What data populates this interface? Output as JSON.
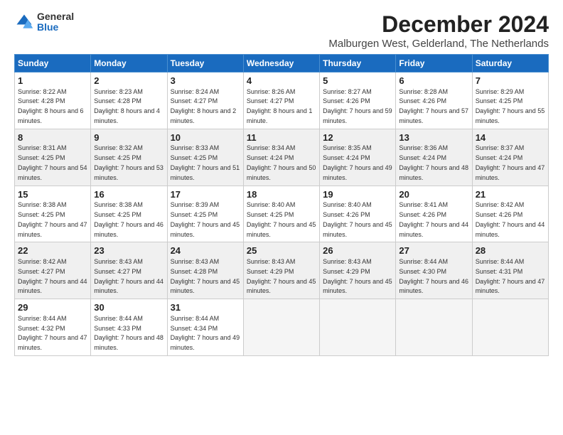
{
  "logo": {
    "general": "General",
    "blue": "Blue"
  },
  "title": "December 2024",
  "subtitle": "Malburgen West, Gelderland, The Netherlands",
  "headers": [
    "Sunday",
    "Monday",
    "Tuesday",
    "Wednesday",
    "Thursday",
    "Friday",
    "Saturday"
  ],
  "weeks": [
    [
      {
        "day": "1",
        "sunrise": "Sunrise: 8:22 AM",
        "sunset": "Sunset: 4:28 PM",
        "daylight": "Daylight: 8 hours and 6 minutes."
      },
      {
        "day": "2",
        "sunrise": "Sunrise: 8:23 AM",
        "sunset": "Sunset: 4:28 PM",
        "daylight": "Daylight: 8 hours and 4 minutes."
      },
      {
        "day": "3",
        "sunrise": "Sunrise: 8:24 AM",
        "sunset": "Sunset: 4:27 PM",
        "daylight": "Daylight: 8 hours and 2 minutes."
      },
      {
        "day": "4",
        "sunrise": "Sunrise: 8:26 AM",
        "sunset": "Sunset: 4:27 PM",
        "daylight": "Daylight: 8 hours and 1 minute."
      },
      {
        "day": "5",
        "sunrise": "Sunrise: 8:27 AM",
        "sunset": "Sunset: 4:26 PM",
        "daylight": "Daylight: 7 hours and 59 minutes."
      },
      {
        "day": "6",
        "sunrise": "Sunrise: 8:28 AM",
        "sunset": "Sunset: 4:26 PM",
        "daylight": "Daylight: 7 hours and 57 minutes."
      },
      {
        "day": "7",
        "sunrise": "Sunrise: 8:29 AM",
        "sunset": "Sunset: 4:25 PM",
        "daylight": "Daylight: 7 hours and 55 minutes."
      }
    ],
    [
      {
        "day": "8",
        "sunrise": "Sunrise: 8:31 AM",
        "sunset": "Sunset: 4:25 PM",
        "daylight": "Daylight: 7 hours and 54 minutes."
      },
      {
        "day": "9",
        "sunrise": "Sunrise: 8:32 AM",
        "sunset": "Sunset: 4:25 PM",
        "daylight": "Daylight: 7 hours and 53 minutes."
      },
      {
        "day": "10",
        "sunrise": "Sunrise: 8:33 AM",
        "sunset": "Sunset: 4:25 PM",
        "daylight": "Daylight: 7 hours and 51 minutes."
      },
      {
        "day": "11",
        "sunrise": "Sunrise: 8:34 AM",
        "sunset": "Sunset: 4:24 PM",
        "daylight": "Daylight: 7 hours and 50 minutes."
      },
      {
        "day": "12",
        "sunrise": "Sunrise: 8:35 AM",
        "sunset": "Sunset: 4:24 PM",
        "daylight": "Daylight: 7 hours and 49 minutes."
      },
      {
        "day": "13",
        "sunrise": "Sunrise: 8:36 AM",
        "sunset": "Sunset: 4:24 PM",
        "daylight": "Daylight: 7 hours and 48 minutes."
      },
      {
        "day": "14",
        "sunrise": "Sunrise: 8:37 AM",
        "sunset": "Sunset: 4:24 PM",
        "daylight": "Daylight: 7 hours and 47 minutes."
      }
    ],
    [
      {
        "day": "15",
        "sunrise": "Sunrise: 8:38 AM",
        "sunset": "Sunset: 4:25 PM",
        "daylight": "Daylight: 7 hours and 47 minutes."
      },
      {
        "day": "16",
        "sunrise": "Sunrise: 8:38 AM",
        "sunset": "Sunset: 4:25 PM",
        "daylight": "Daylight: 7 hours and 46 minutes."
      },
      {
        "day": "17",
        "sunrise": "Sunrise: 8:39 AM",
        "sunset": "Sunset: 4:25 PM",
        "daylight": "Daylight: 7 hours and 45 minutes."
      },
      {
        "day": "18",
        "sunrise": "Sunrise: 8:40 AM",
        "sunset": "Sunset: 4:25 PM",
        "daylight": "Daylight: 7 hours and 45 minutes."
      },
      {
        "day": "19",
        "sunrise": "Sunrise: 8:40 AM",
        "sunset": "Sunset: 4:26 PM",
        "daylight": "Daylight: 7 hours and 45 minutes."
      },
      {
        "day": "20",
        "sunrise": "Sunrise: 8:41 AM",
        "sunset": "Sunset: 4:26 PM",
        "daylight": "Daylight: 7 hours and 44 minutes."
      },
      {
        "day": "21",
        "sunrise": "Sunrise: 8:42 AM",
        "sunset": "Sunset: 4:26 PM",
        "daylight": "Daylight: 7 hours and 44 minutes."
      }
    ],
    [
      {
        "day": "22",
        "sunrise": "Sunrise: 8:42 AM",
        "sunset": "Sunset: 4:27 PM",
        "daylight": "Daylight: 7 hours and 44 minutes."
      },
      {
        "day": "23",
        "sunrise": "Sunrise: 8:43 AM",
        "sunset": "Sunset: 4:27 PM",
        "daylight": "Daylight: 7 hours and 44 minutes."
      },
      {
        "day": "24",
        "sunrise": "Sunrise: 8:43 AM",
        "sunset": "Sunset: 4:28 PM",
        "daylight": "Daylight: 7 hours and 45 minutes."
      },
      {
        "day": "25",
        "sunrise": "Sunrise: 8:43 AM",
        "sunset": "Sunset: 4:29 PM",
        "daylight": "Daylight: 7 hours and 45 minutes."
      },
      {
        "day": "26",
        "sunrise": "Sunrise: 8:43 AM",
        "sunset": "Sunset: 4:29 PM",
        "daylight": "Daylight: 7 hours and 45 minutes."
      },
      {
        "day": "27",
        "sunrise": "Sunrise: 8:44 AM",
        "sunset": "Sunset: 4:30 PM",
        "daylight": "Daylight: 7 hours and 46 minutes."
      },
      {
        "day": "28",
        "sunrise": "Sunrise: 8:44 AM",
        "sunset": "Sunset: 4:31 PM",
        "daylight": "Daylight: 7 hours and 47 minutes."
      }
    ],
    [
      {
        "day": "29",
        "sunrise": "Sunrise: 8:44 AM",
        "sunset": "Sunset: 4:32 PM",
        "daylight": "Daylight: 7 hours and 47 minutes."
      },
      {
        "day": "30",
        "sunrise": "Sunrise: 8:44 AM",
        "sunset": "Sunset: 4:33 PM",
        "daylight": "Daylight: 7 hours and 48 minutes."
      },
      {
        "day": "31",
        "sunrise": "Sunrise: 8:44 AM",
        "sunset": "Sunset: 4:34 PM",
        "daylight": "Daylight: 7 hours and 49 minutes."
      },
      null,
      null,
      null,
      null
    ]
  ]
}
